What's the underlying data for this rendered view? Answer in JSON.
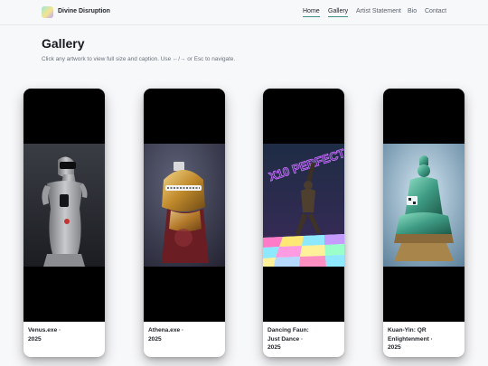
{
  "header": {
    "brand": "Divine Disruption",
    "nav": [
      "Home",
      "Gallery",
      "Artist Statement",
      "Bio",
      "Contact"
    ],
    "active": "Gallery"
  },
  "main": {
    "title": "Gallery",
    "hint": "Click any artwork to view full size and caption. Use ←/→ or Esc to navigate."
  },
  "gallery": [
    {
      "title": "Venus.exe ·",
      "year": "2025"
    },
    {
      "title": "Athena.exe ·",
      "year": "2025"
    },
    {
      "title": "Dancing Faun:",
      "title2": "Just Dance ·",
      "year": "2025",
      "neon_text": "X10 PERFECT"
    },
    {
      "title": "Kuan-Yin: QR",
      "title2": "Enlightenment ·",
      "year": "2025"
    }
  ]
}
